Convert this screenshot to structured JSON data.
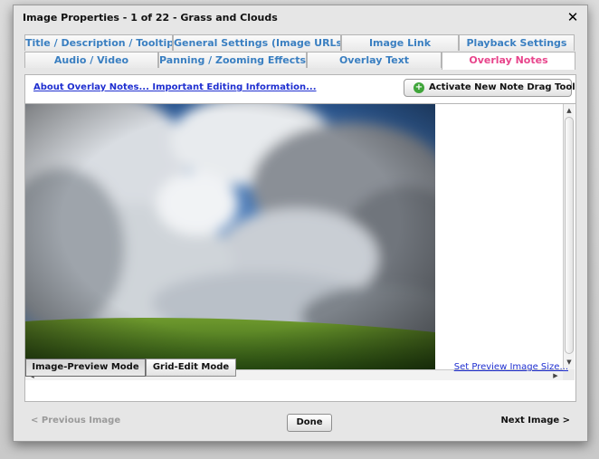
{
  "dialog": {
    "title": "Image Properties - 1 of 22 - Grass and Clouds",
    "close_glyph": "✕"
  },
  "tabs": {
    "row1": [
      {
        "label": "Title / Description / Tooltip"
      },
      {
        "label": "General Settings (Image URLs)"
      },
      {
        "label": "Image Link"
      },
      {
        "label": "Playback Settings"
      }
    ],
    "row2": [
      {
        "label": "Audio / Video"
      },
      {
        "label": "Panning / Zooming Effects"
      },
      {
        "label": "Overlay Text"
      },
      {
        "label": "Overlay Notes"
      }
    ],
    "active": "Overlay Notes"
  },
  "panel": {
    "about_link": "About Overlay Notes... Important Editing Information...",
    "drag_tool_button": "Activate New Note Drag Tool",
    "drag_tool_icon": "plus-circle-icon",
    "mode_preview": "Image-Preview Mode",
    "mode_grid": "Grid-Edit Mode",
    "active_mode": "Image-Preview Mode",
    "preview_size_link": "Set Preview Image Size..."
  },
  "footer": {
    "previous": "< Previous Image",
    "done": "Done",
    "next": "Next Image >"
  },
  "colors": {
    "active_tab": "#e8458c",
    "tab_text": "#3a7fc1",
    "link": "#1f2fd0",
    "icon_green": "#3fa53a"
  }
}
